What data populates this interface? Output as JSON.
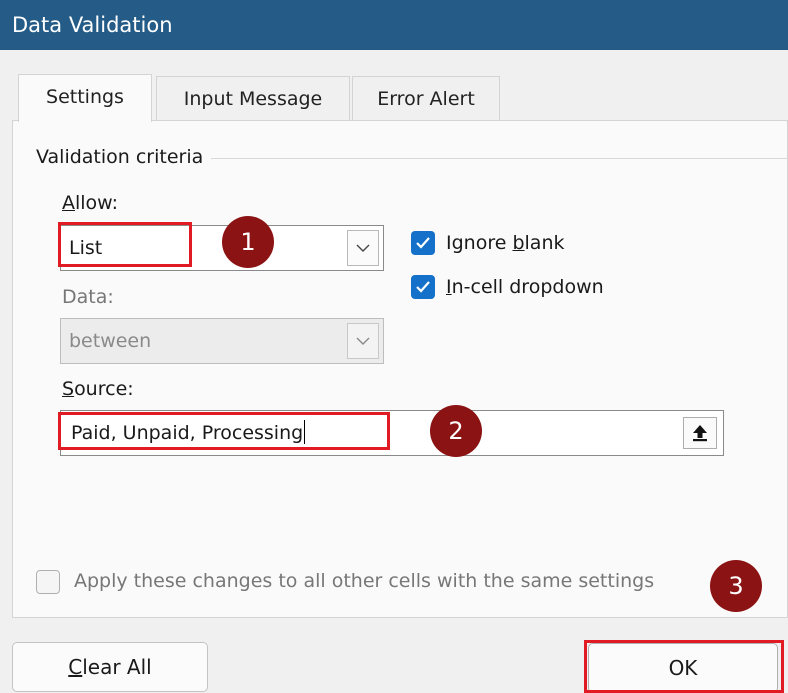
{
  "dialog": {
    "title": "Data Validation"
  },
  "tabs": [
    {
      "label": "Settings",
      "active": true
    },
    {
      "label": "Input Message",
      "active": false
    },
    {
      "label": "Error Alert",
      "active": false
    }
  ],
  "criteria": {
    "group_label": "Validation criteria",
    "allow": {
      "label_underlined": "A",
      "label_rest": "llow:",
      "value": "List"
    },
    "data": {
      "label": "Data:",
      "value": "between"
    },
    "ignore_blank": {
      "label_pre": "Ignore ",
      "label_underlined": "b",
      "label_post": "lank",
      "checked": true
    },
    "in_cell_dropdown": {
      "label_underlined": "I",
      "label_rest": "n-cell dropdown",
      "checked": true
    },
    "source": {
      "label_underlined": "S",
      "label_rest": "ource:",
      "value": "Paid, Unpaid, Processing"
    }
  },
  "apply_all": {
    "label": "Apply these changes to all other cells with the same settings",
    "checked": false
  },
  "buttons": {
    "clear_all_underlined": "C",
    "clear_all_rest": "lear All",
    "ok": "OK"
  },
  "markers": [
    "1",
    "2",
    "3"
  ],
  "colors": {
    "title_bar": "#255c87",
    "checkbox": "#1470c8",
    "highlight": "#e01b24",
    "marker": "#8b1313"
  }
}
